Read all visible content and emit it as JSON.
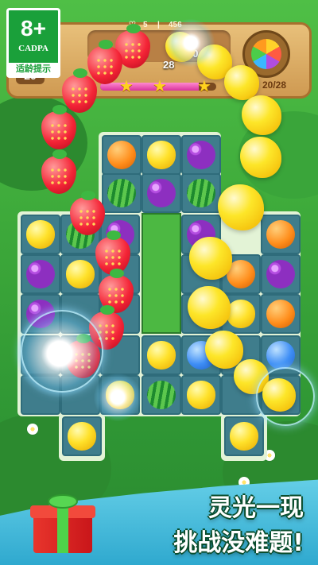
{
  "age_rating": {
    "rating": "8+",
    "org": "CADPA",
    "hint": "适龄提示"
  },
  "hud": {
    "lives": "5",
    "level": "456",
    "left_score": "20",
    "float_scores": [
      "30",
      "28",
      "30"
    ],
    "moves": "20/28",
    "stars_earned": 3,
    "progress": 0.85
  },
  "board": {
    "fruits": [
      "orange",
      "lemon",
      "grape",
      "melon",
      "grape",
      "melon",
      "lemon",
      "melon",
      "grape",
      "grape",
      "orange",
      "grape",
      "lemon",
      "orange",
      "grape",
      "grape",
      "lemon",
      "orange",
      "lemon",
      "blue",
      "blue",
      "lemon",
      "melon",
      "lemon",
      "lemon",
      "lemon"
    ]
  },
  "slogan": {
    "line1": "灵光一现",
    "line2": "挑战没难题!"
  },
  "colors": {
    "grass": "#3da93a",
    "tile": "#3f7d8c",
    "panel": "#d8a862",
    "slogan_outline": "#0a4d2d"
  }
}
